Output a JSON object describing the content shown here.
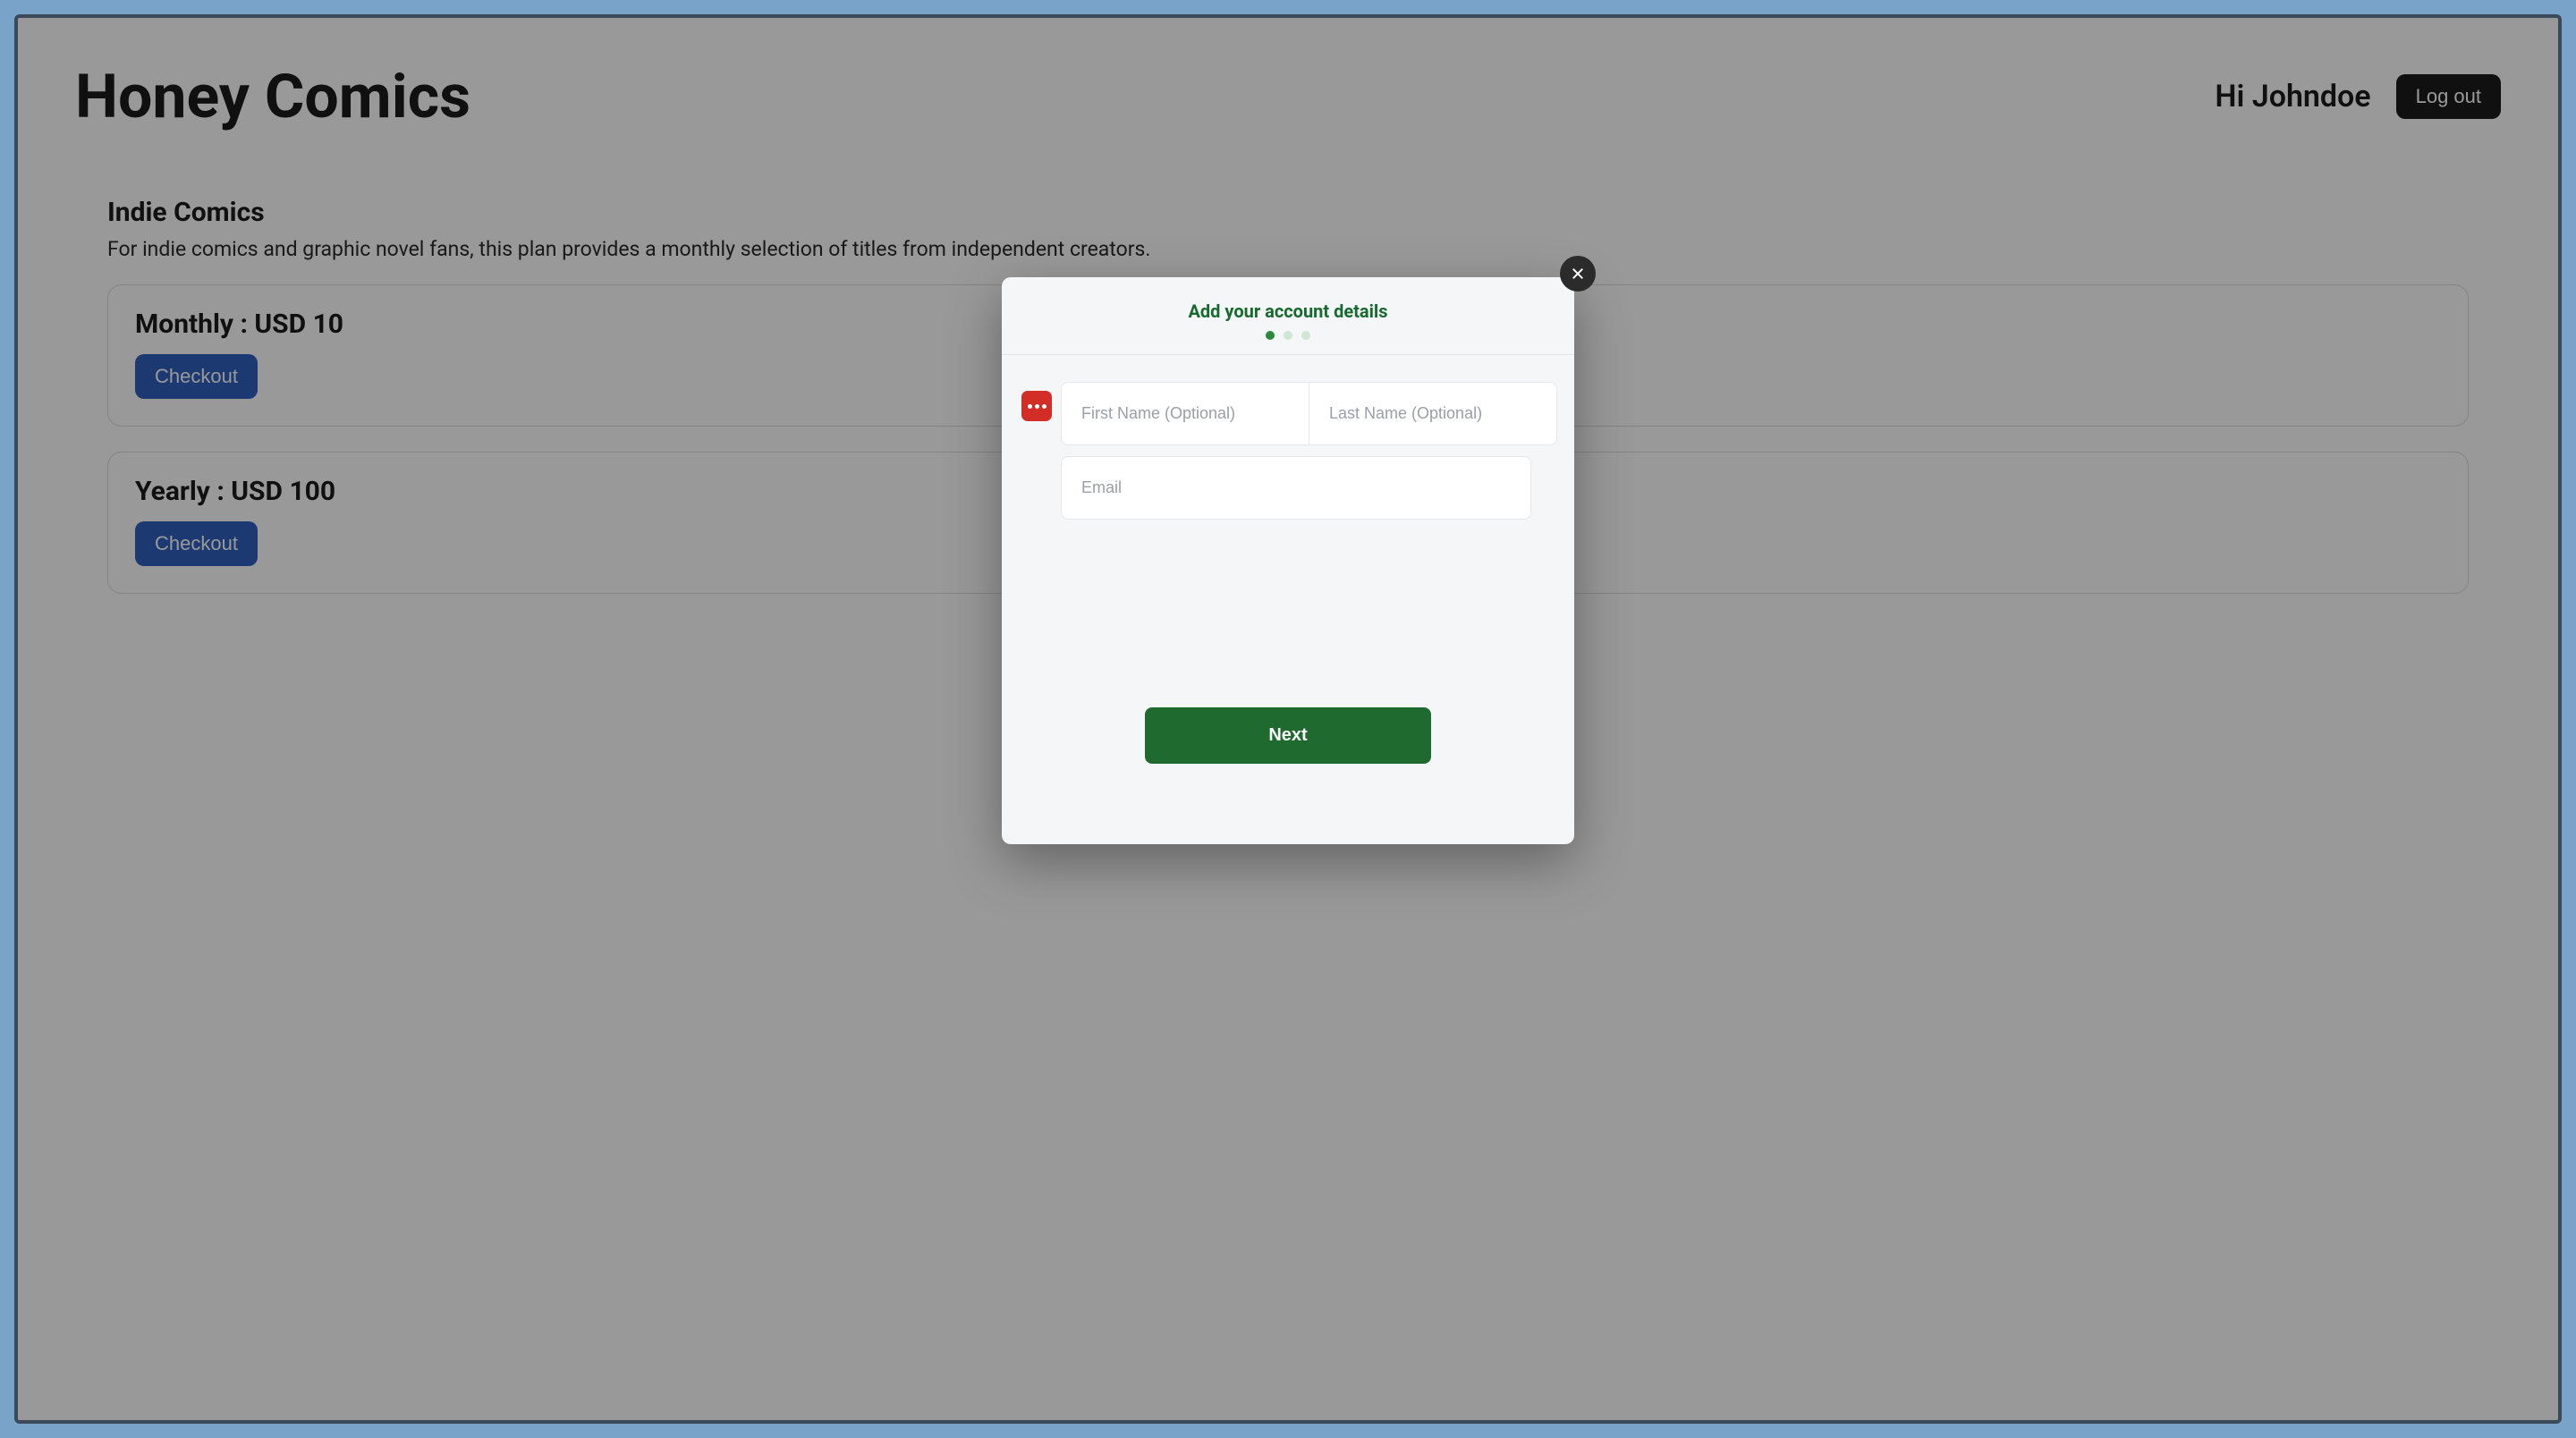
{
  "header": {
    "site_title": "Honey Comics",
    "greeting": "Hi Johndoe",
    "logout_label": "Log out"
  },
  "section": {
    "title": "Indie Comics",
    "description": "For indie comics and graphic novel fans, this plan provides a monthly selection of titles from independent creators."
  },
  "plans": [
    {
      "label": "Monthly : USD 10",
      "checkout": "Checkout"
    },
    {
      "label": "Yearly : USD 100",
      "checkout": "Checkout"
    }
  ],
  "modal": {
    "title": "Add your account details",
    "step_active": 0,
    "step_count": 3,
    "first_name_placeholder": "First Name (Optional)",
    "last_name_placeholder": "Last Name (Optional)",
    "email_placeholder": "Email",
    "next_label": "Next",
    "first_name_value": "",
    "last_name_value": "",
    "email_value": ""
  },
  "icons": {
    "close": "close-icon",
    "passmgr": "password-manager-icon"
  },
  "colors": {
    "accent_green": "#1e6a2f",
    "button_blue": "#2f5fbf",
    "badge_red": "#d32d27",
    "text_dark": "#1c1c1c"
  }
}
